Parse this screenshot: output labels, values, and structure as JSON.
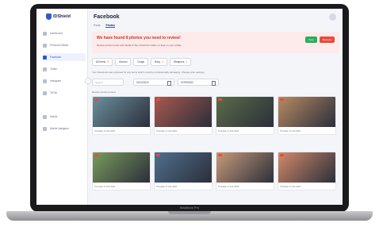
{
  "device": {
    "brand": "MacBook Pro"
  },
  "sidebar": {
    "logo": "IDShield",
    "items": [
      {
        "label": "Dashboard",
        "icon": "grid-icon"
      },
      {
        "label": "Personal Details",
        "icon": "user-icon"
      },
      {
        "label": "Facebook",
        "icon": "facebook-icon"
      },
      {
        "label": "Twitter",
        "icon": "twitter-icon"
      },
      {
        "label": "Instagram",
        "icon": "instagram-icon"
      },
      {
        "label": "TikTok",
        "icon": "tiktok-icon"
      },
      {
        "label": "Mobile",
        "icon": "phone-icon"
      },
      {
        "label": "Mobile Navigator",
        "icon": "compass-icon"
      }
    ]
  },
  "header": {
    "title": "Facebook",
    "tabs": [
      {
        "label": "Posts"
      },
      {
        "label": "Photos"
      }
    ]
  },
  "alert": {
    "title": "We have found 8 photos you need to review!",
    "subtitle": "Review photos below and decide if they should be hidden or kept on your profile.",
    "keep_label": "Keep",
    "remove_label": "Remove"
  },
  "filters": [
    {
      "label": "All Items",
      "count": "8"
    },
    {
      "label": "Alcohol",
      "count": ""
    },
    {
      "label": "Drugs",
      "count": ""
    },
    {
      "label": "Racy",
      "count": "4"
    },
    {
      "label": "Weapons",
      "count": "4"
    }
  ],
  "hint": "Your Facebook was reviewed for any items which could be professionally damaging. Change scan settings",
  "search": {
    "placeholder": "Search"
  },
  "date_from": "02/11/2022",
  "date_to": "07/09/2022",
  "groups": [
    {
      "label": "Review photos posted"
    }
  ],
  "photos": [
    {
      "caption": "Thursday 17 Feb 2022",
      "color": "#6b8f9c"
    },
    {
      "caption": "Thursday 17 Feb 2022",
      "color": "#a8584f"
    },
    {
      "caption": "Thursday 17 Feb 2022",
      "color": "#5c6b48"
    },
    {
      "caption": "Thursday 17 Feb 2022",
      "color": "#b88a64"
    },
    {
      "caption": "Thursday 17 Feb 2022",
      "color": "#7a9a5c"
    },
    {
      "caption": "Thursday 17 Feb 2022",
      "color": "#4f6f8c"
    },
    {
      "caption": "Thursday 17 Feb 2022",
      "color": "#c79a7a"
    },
    {
      "caption": "Thursday 17 Feb 2022",
      "color": "#d28a6a"
    }
  ]
}
